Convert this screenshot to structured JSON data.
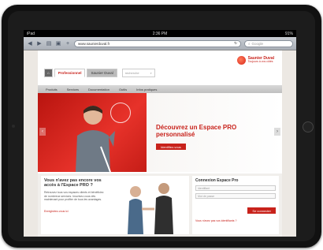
{
  "status_bar": {
    "device": "iPad",
    "time": "2:36 PM",
    "battery": "91%"
  },
  "browser": {
    "url": "www.saunierduval.fr",
    "search_placeholder": "Google"
  },
  "site": {
    "logo": {
      "name": "Saunier Duval",
      "tagline": "Toujours à vos côtés"
    },
    "tabs": [
      {
        "label": "Professionnel"
      },
      {
        "label": "Saunier Duval"
      }
    ],
    "search_placeholder": "recherche",
    "nav": [
      "Produits",
      "Services",
      "Documentation",
      "Outils",
      "Infos pratiques"
    ],
    "hero": {
      "title": "Découvrez un Espace PRO personnalisé",
      "button": "Identifiez-vous"
    },
    "promo": {
      "title": "Vous n'avez pas encore vos accès à l'Espace PRO ?",
      "text": "Retrouvez tous vos espaces clients et bénéficiez de nombreux services. Inscrivez-vous dès maintenant pour profiter de tous les avantages.",
      "link": "Enregistrez-vous ici"
    },
    "login": {
      "title": "Connexion Espace Pro",
      "email_placeholder": "Identifiant",
      "password_placeholder": "Mot de passe",
      "button": "Se connecter",
      "forgot": "Vous n'avez pas vos identifiants ?"
    }
  },
  "colors": {
    "brand": "#c8221b",
    "bezel": "#111111"
  }
}
